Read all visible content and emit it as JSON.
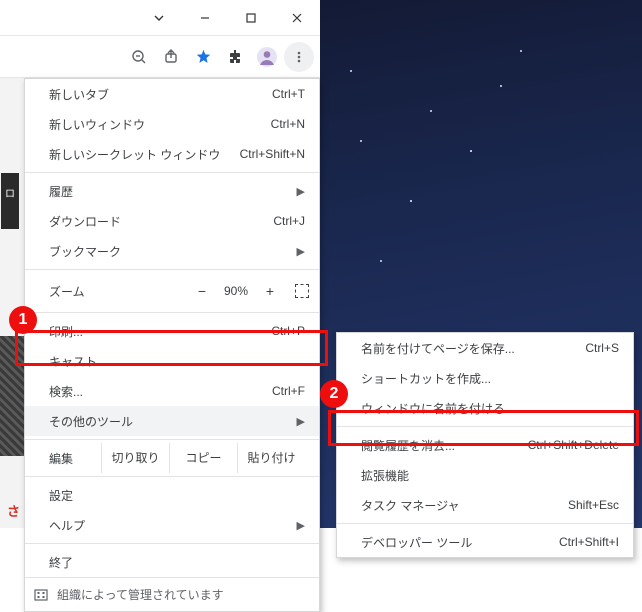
{
  "callouts": {
    "num1": "1",
    "num2": "2"
  },
  "window": {
    "toolbar": {
      "zoom_out": "−",
      "share": "↗",
      "star": "★",
      "extensions": "✦",
      "profile": "◯",
      "menu": "⋮"
    }
  },
  "menu": {
    "newTab": {
      "label": "新しいタブ",
      "shortcut": "Ctrl+T"
    },
    "newWindow": {
      "label": "新しいウィンドウ",
      "shortcut": "Ctrl+N"
    },
    "incognito": {
      "label": "新しいシークレット ウィンドウ",
      "shortcut": "Ctrl+Shift+N"
    },
    "history": {
      "label": "履歴"
    },
    "downloads": {
      "label": "ダウンロード",
      "shortcut": "Ctrl+J"
    },
    "bookmarks": {
      "label": "ブックマーク"
    },
    "zoom": {
      "label": "ズーム",
      "minus": "−",
      "value": "90%",
      "plus": "+"
    },
    "print": {
      "label": "印刷...",
      "shortcut": "Ctrl+P"
    },
    "cast": {
      "label": "キャスト..."
    },
    "find": {
      "label": "検索...",
      "shortcut": "Ctrl+F"
    },
    "moreTools": {
      "label": "その他のツール"
    },
    "edit": {
      "label": "編集",
      "cut": "切り取り",
      "copy": "コピー",
      "paste": "貼り付け"
    },
    "settings": {
      "label": "設定"
    },
    "help": {
      "label": "ヘルプ"
    },
    "exit": {
      "label": "終了"
    },
    "managed": {
      "label": "組織によって管理されています"
    }
  },
  "submenu": {
    "savePage": {
      "label": "名前を付けてページを保存...",
      "shortcut": "Ctrl+S"
    },
    "createShortcut": {
      "label": "ショートカットを作成..."
    },
    "nameWindow": {
      "label": "ウィンドウに名前を付ける..."
    },
    "clearData": {
      "label": "閲覧履歴を消去...",
      "shortcut": "Ctrl+Shift+Delete"
    },
    "extensions": {
      "label": "拡張機能"
    },
    "taskManager": {
      "label": "タスク マネージャ",
      "shortcut": "Shift+Esc"
    },
    "devTools": {
      "label": "デベロッパー ツール",
      "shortcut": "Ctrl+Shift+I"
    }
  },
  "strip": {
    "dark": "ロ",
    "red": "さ"
  }
}
